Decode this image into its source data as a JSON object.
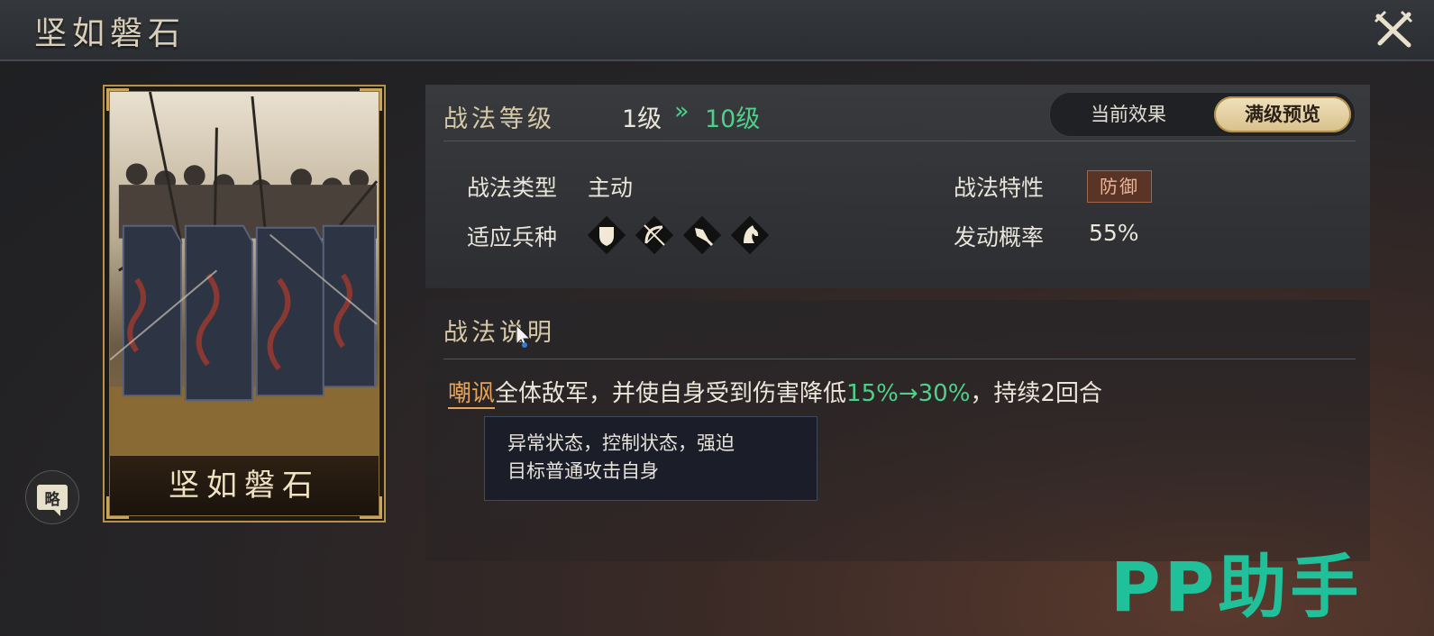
{
  "window": {
    "title": "坚如磐石"
  },
  "card": {
    "name": "坚如磐石",
    "brief_label": "略"
  },
  "level": {
    "section_title": "战法等级",
    "from": "1级",
    "arrow": "»",
    "to": "10级",
    "toggle_current": "当前效果",
    "toggle_max": "满级预览"
  },
  "attributes": {
    "type_label": "战法类型",
    "type_value": "主动",
    "trait_label": "战法特性",
    "trait_value": "防御",
    "units_label": "适应兵种",
    "units": [
      "shield-icon",
      "bow-icon",
      "spear-icon",
      "horse-icon"
    ],
    "rate_label": "发动概率",
    "rate_value": "55%"
  },
  "description": {
    "section_title": "战法说明",
    "keyword": "嘲讽",
    "text_1": "全体敌军，并使自身受到伤害降低",
    "value": "15%→30%",
    "text_2": "，持续2回合"
  },
  "tooltip": {
    "line1": "异常状态，控制状态，强迫",
    "line2": "目标普通攻击自身"
  },
  "watermark": "PP助手",
  "colors": {
    "accent_green": "#4fd08a",
    "keyword_orange": "#e6a45a",
    "gold": "#b8924a"
  }
}
